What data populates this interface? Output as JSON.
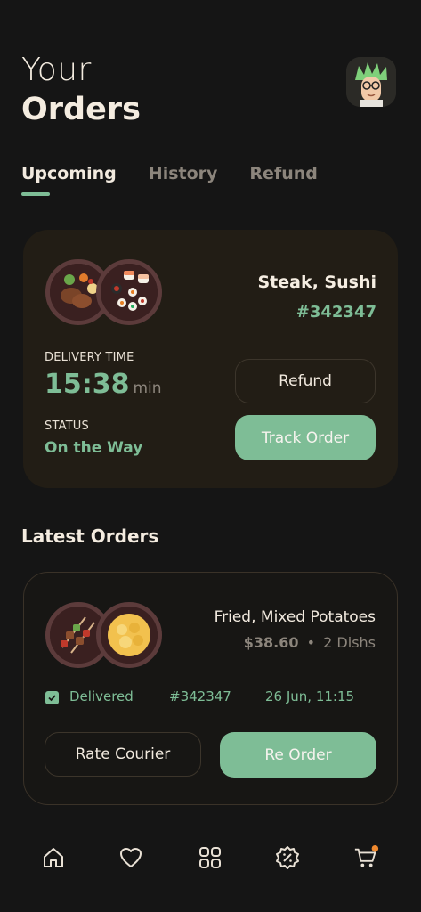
{
  "header": {
    "title_line1": "Your",
    "title_line2": "Orders"
  },
  "tabs": [
    {
      "label": "Upcoming",
      "active": true
    },
    {
      "label": "History",
      "active": false
    },
    {
      "label": "Refund",
      "active": false
    }
  ],
  "upcoming_order": {
    "items": "Steak, Sushi",
    "order_id": "#342347",
    "delivery_time_label": "DELIVERY TIME",
    "delivery_time": "15:38",
    "delivery_time_unit": "min",
    "status_label": "STATUS",
    "status": "On the Way",
    "refund_button": "Refund",
    "track_button": "Track Order"
  },
  "latest": {
    "section_title": "Latest Orders",
    "items": "Fried, Mixed Potatoes",
    "price": "$38.60",
    "separator": "•",
    "dishes": "2 Dishs",
    "status": "Delivered",
    "order_id": "#342347",
    "date": "26 Jun, 11:15",
    "rate_button": "Rate Courier",
    "reorder_button": "Re Order"
  },
  "nav": {
    "items": [
      "home-icon",
      "heart-icon",
      "grid-icon",
      "discount-icon",
      "cart-icon"
    ]
  },
  "colors": {
    "background": "#151515",
    "accent": "#7ebd96",
    "card": "#221d15",
    "notification": "#f0892e"
  }
}
